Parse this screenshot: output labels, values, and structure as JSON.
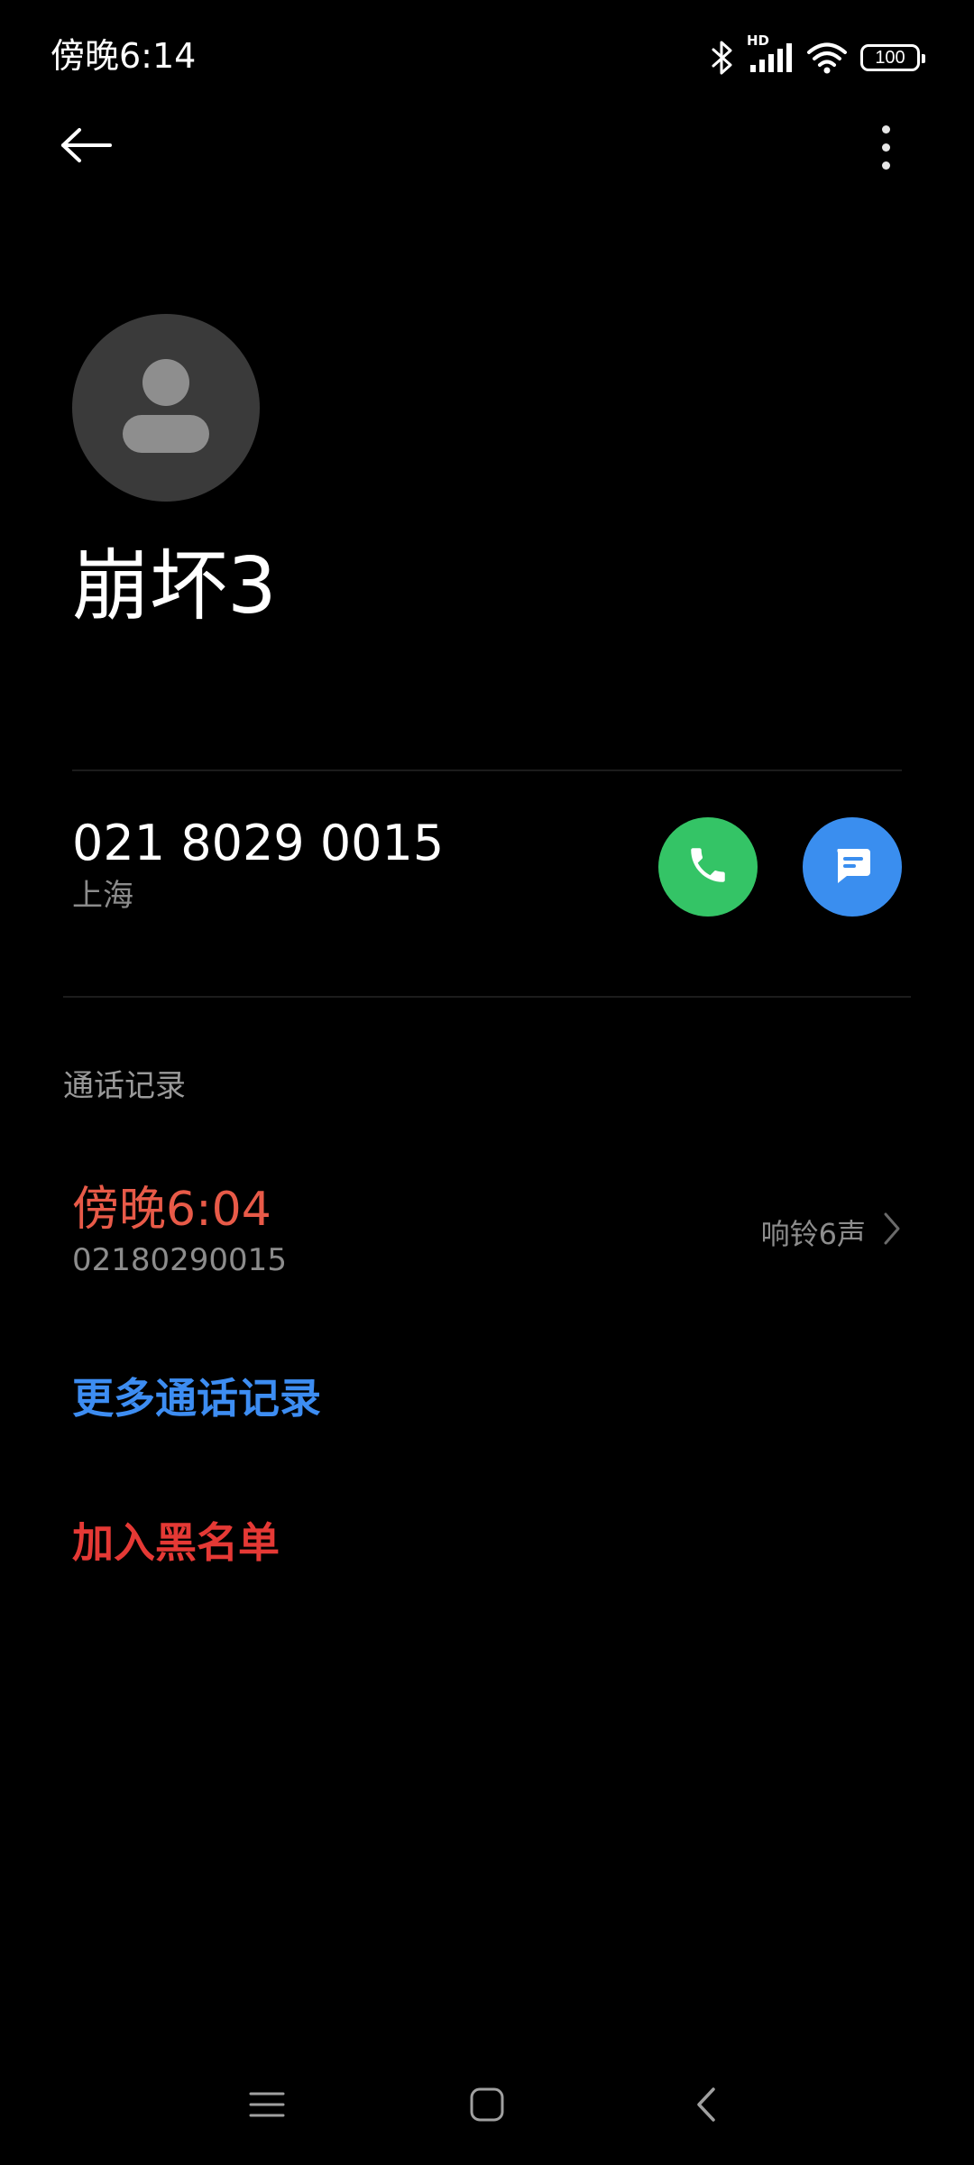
{
  "status_bar": {
    "time": "傍晚6:14",
    "network_label": "HD",
    "battery": "100",
    "icons": [
      "bluetooth-icon",
      "signal-icon",
      "wifi-icon",
      "battery-icon"
    ]
  },
  "top_bar": {
    "back_icon": "arrow-left-icon",
    "more_icon": "more-vertical-icon"
  },
  "contact": {
    "name": "崩坏3",
    "avatar_icon": "person-icon",
    "number": "021 8029 0015",
    "location": "上海",
    "call_icon": "phone-icon",
    "message_icon": "message-icon"
  },
  "call_log": {
    "title": "通话记录",
    "entries": [
      {
        "time": "傍晚6:04",
        "number": "02180290015",
        "detail": "响铃6声"
      }
    ],
    "more_label": "更多通话记录"
  },
  "actions": {
    "blacklist_label": "加入黑名单"
  },
  "nav_bar": {
    "icons": [
      "menu-icon",
      "home-icon",
      "back-nav-icon"
    ]
  },
  "colors": {
    "background": "#000000",
    "call_button": "#34c466",
    "message_button": "#3a8eef",
    "missed_call": "#e85a48",
    "link_blue": "#3d8df2",
    "danger_red": "#e53935"
  }
}
